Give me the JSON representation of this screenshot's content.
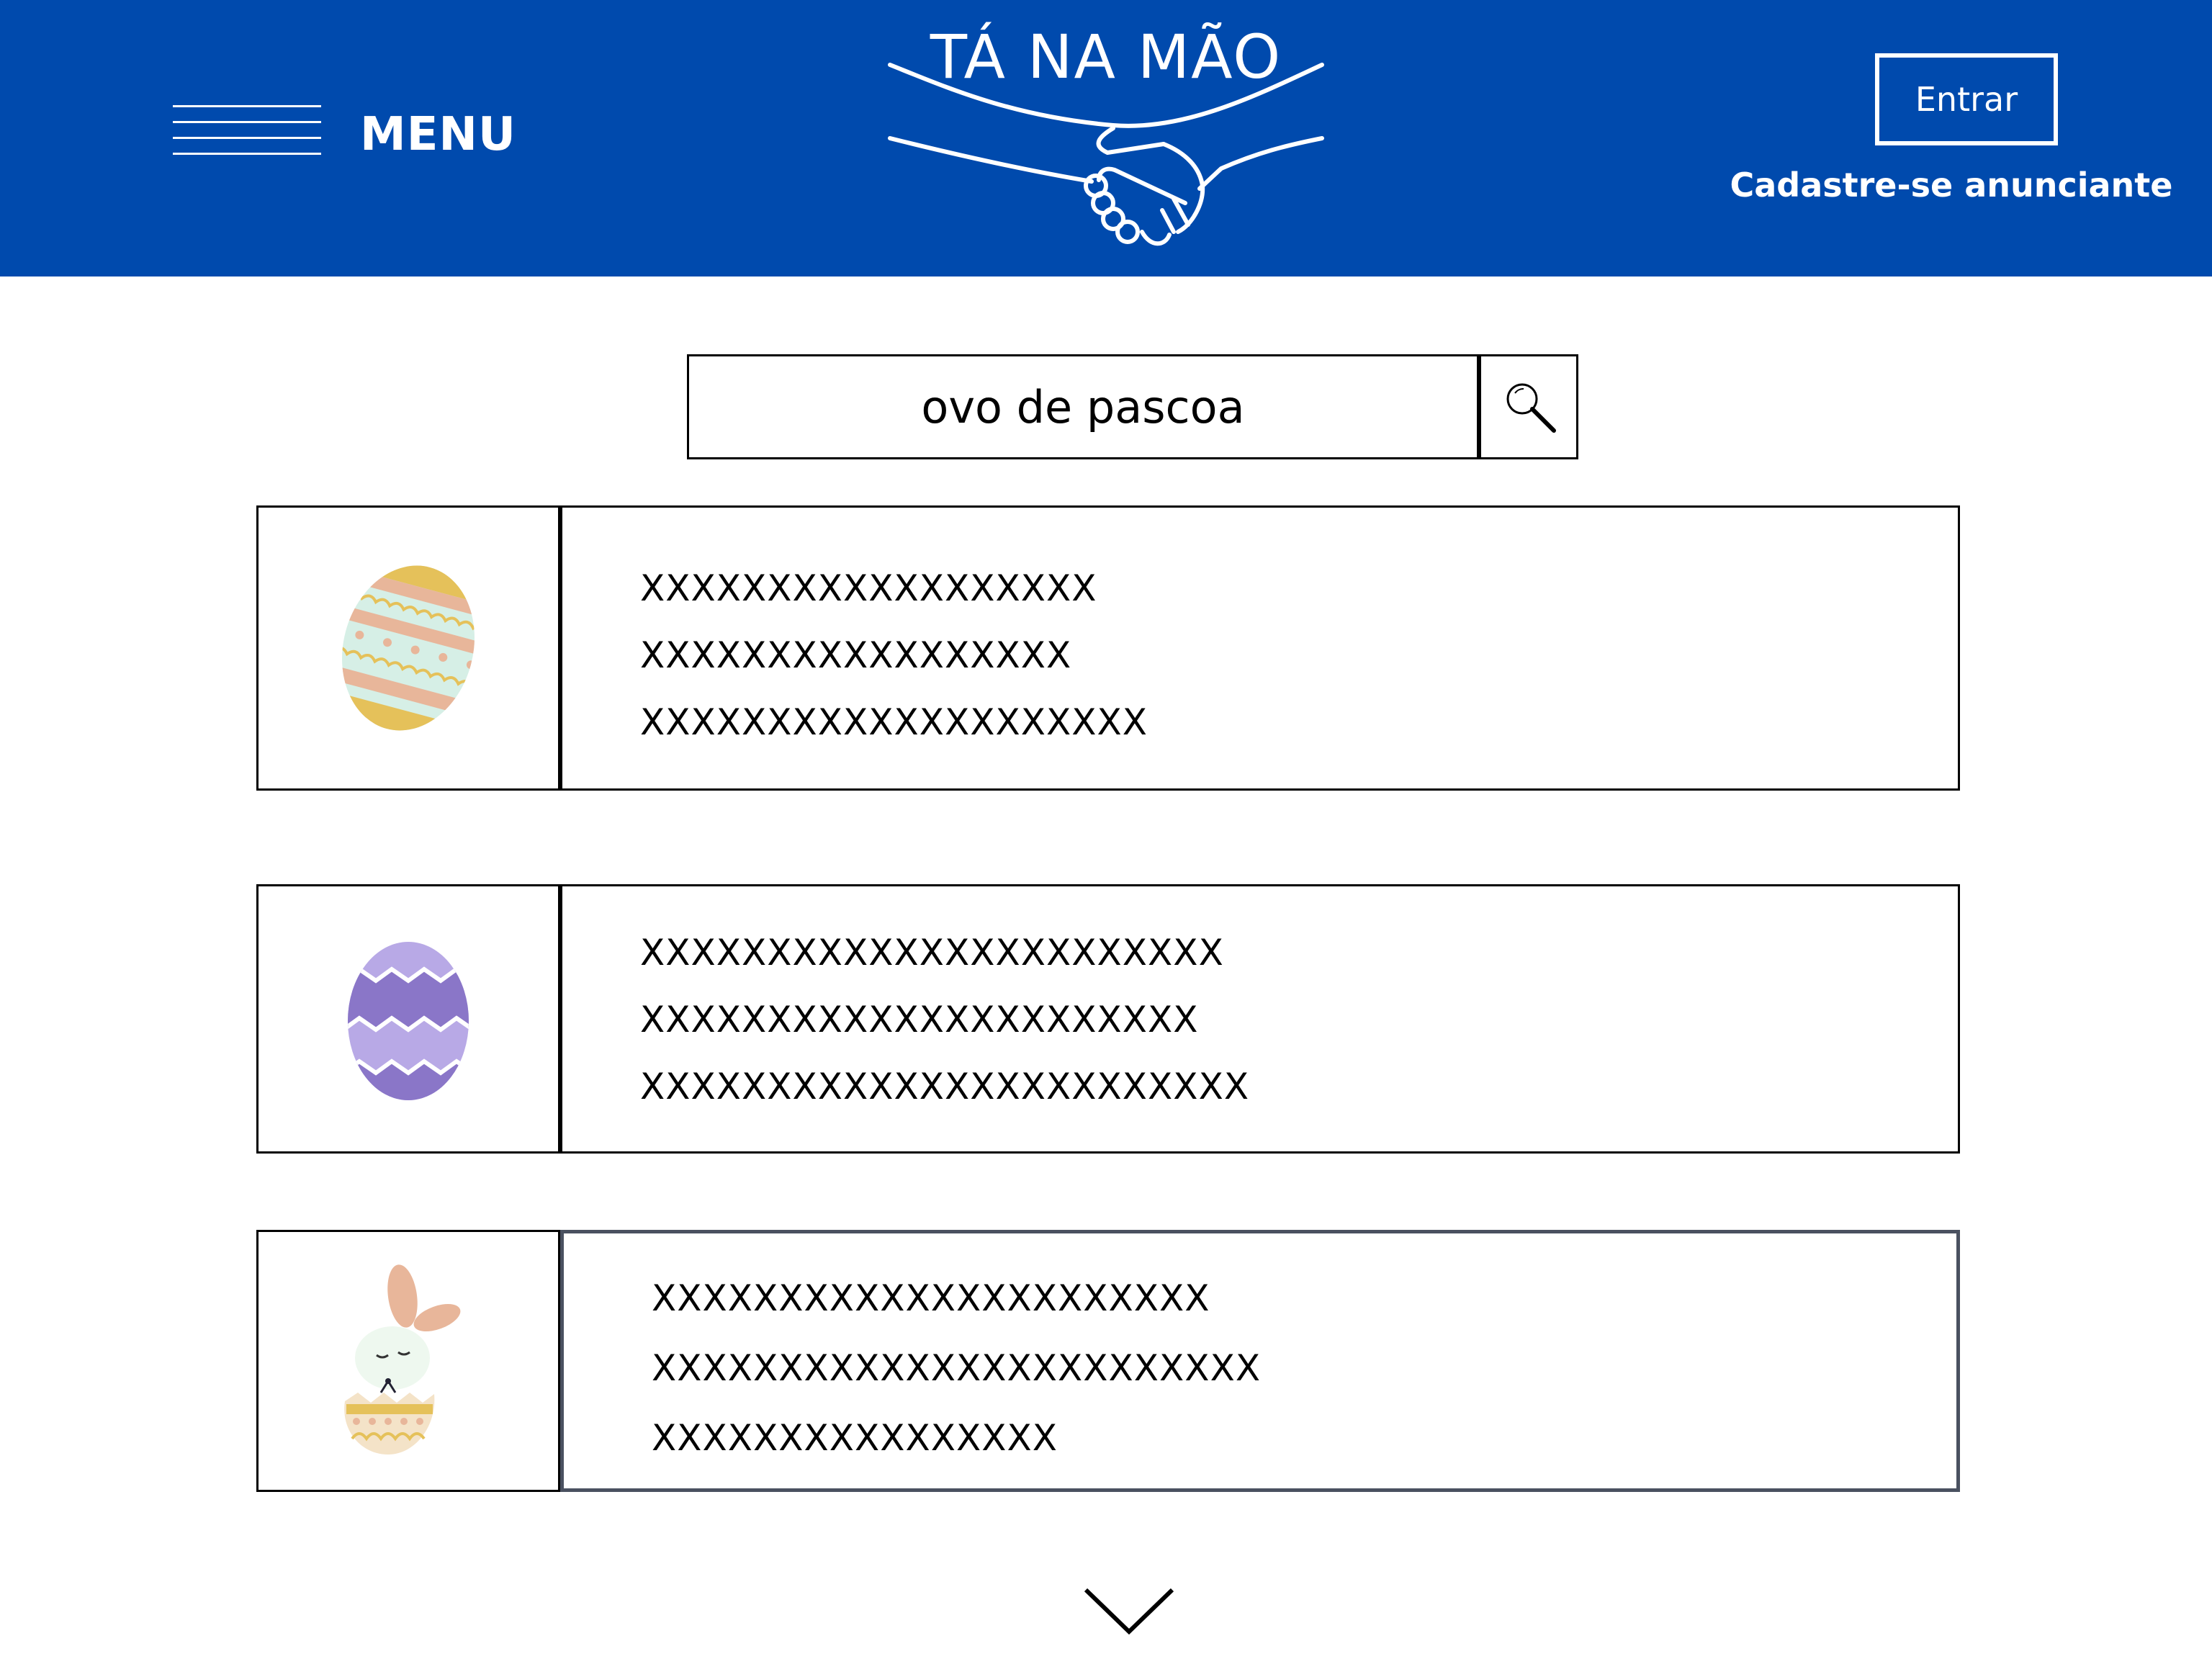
{
  "header": {
    "menu_label": "MENU",
    "logo_text": "TÁ NA MÃO",
    "login_label": "Entrar",
    "signup_label": "Cadastre-se anunciante"
  },
  "search": {
    "query": "ovo de pascoa",
    "icon": "search-icon"
  },
  "results": [
    {
      "image": "easter-egg-striped-icon",
      "lines": [
        "XXXXXXXXXXXXXXXXXX",
        "XXXXXXXXXXXXXXXXX",
        "XXXXXXXXXXXXXXXXXXXX"
      ]
    },
    {
      "image": "easter-egg-purple-icon",
      "lines": [
        "XXXXXXXXXXXXXXXXXXXXXXX",
        "XXXXXXXXXXXXXXXXXXXXXX",
        "XXXXXXXXXXXXXXXXXXXXXXXX"
      ]
    },
    {
      "image": "easter-bunny-egg-icon",
      "lines": [
        "XXXXXXXXXXXXXXXXXXXXXX",
        "XXXXXXXXXXXXXXXXXXXXXXXX",
        "XXXXXXXXXXXXXXXX"
      ]
    }
  ],
  "colors": {
    "brand_blue": "#004aad",
    "white": "#ffffff",
    "border": "#000000"
  }
}
